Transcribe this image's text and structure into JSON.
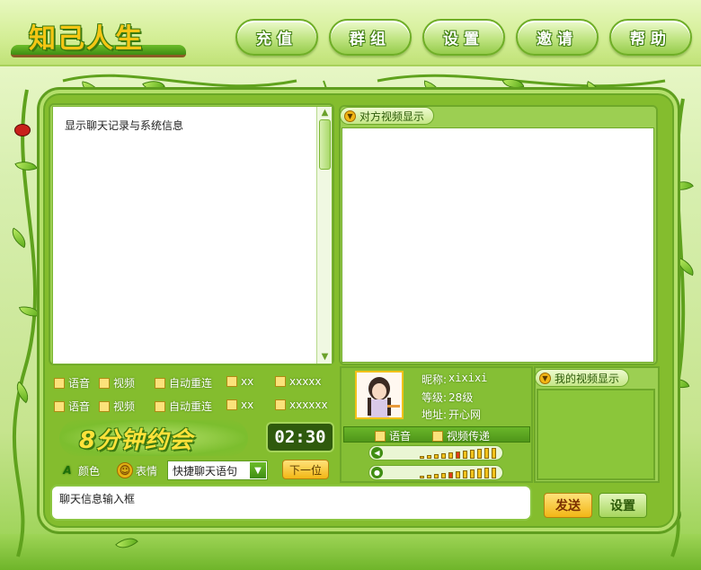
{
  "app": {
    "logo_text": "知己人生"
  },
  "nav": {
    "items": [
      {
        "label": "充值",
        "name": "nav-recharge-button"
      },
      {
        "label": "群组",
        "name": "nav-groups-button"
      },
      {
        "label": "设置",
        "name": "nav-settings-button"
      },
      {
        "label": "邀请",
        "name": "nav-invite-button"
      },
      {
        "label": "帮助",
        "name": "nav-help-button"
      }
    ]
  },
  "chat": {
    "log_placeholder": "显示聊天记录与系统信息",
    "options_row1": [
      "语音",
      "视频",
      "自动重连",
      "xx",
      "xxxxx"
    ],
    "options_row2": [
      "语音",
      "视频",
      "自动重连",
      "xx",
      "xxxxxx"
    ],
    "banner": "8分钟约会",
    "timer": "02:30",
    "color_label": "颜色",
    "emotion_label": "表情",
    "quick_phrase": "快捷聊天语句",
    "next_label": "下一位",
    "input_placeholder": "聊天信息输入框",
    "send_label": "发送",
    "settings_label": "设置"
  },
  "partner_video": {
    "label": "对方视频显示"
  },
  "profile": {
    "nickname_label": "昵称:",
    "nickname": "xixixi",
    "level_label": "等级:",
    "level": "28级",
    "address_label": "地址:",
    "address": "开心网",
    "voice_label": "语音",
    "video_label": "视频传递",
    "mic_level": 0.35,
    "speaker_level": 0.45
  },
  "my_video": {
    "label": "我的视频显示"
  },
  "colors": {
    "frame_green": "#84bd2e",
    "accent_yellow": "#f2b615",
    "dark_green": "#3f7e0f"
  }
}
